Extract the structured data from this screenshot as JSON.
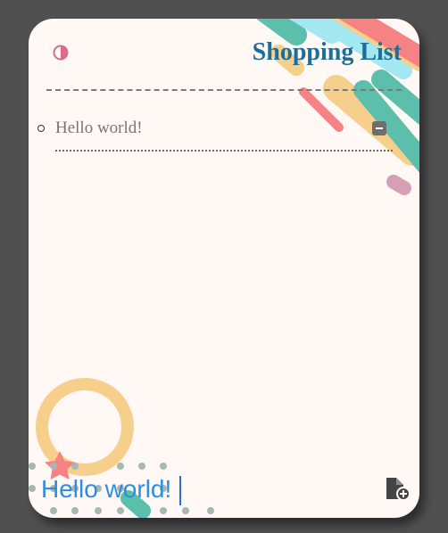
{
  "header": {
    "title": "Shopping List",
    "theme_toggle_icon": "half-circle-contrast-icon"
  },
  "items": [
    {
      "text": "Hello world!",
      "remove_icon": "minus-square-icon"
    }
  ],
  "new_item": {
    "value": "Hello world!",
    "add_icon": "file-plus-icon"
  },
  "colors": {
    "card_background": "#fff8f5",
    "page_background": "#505050",
    "title": "#1d6f96",
    "input_text": "#2a8fe0",
    "accent_pink": "#d96c8d",
    "deco_teal": "#5bbfac",
    "deco_yellow": "#f6cf8c",
    "deco_coral": "#f58383",
    "deco_cyan": "#a3e8f1"
  }
}
